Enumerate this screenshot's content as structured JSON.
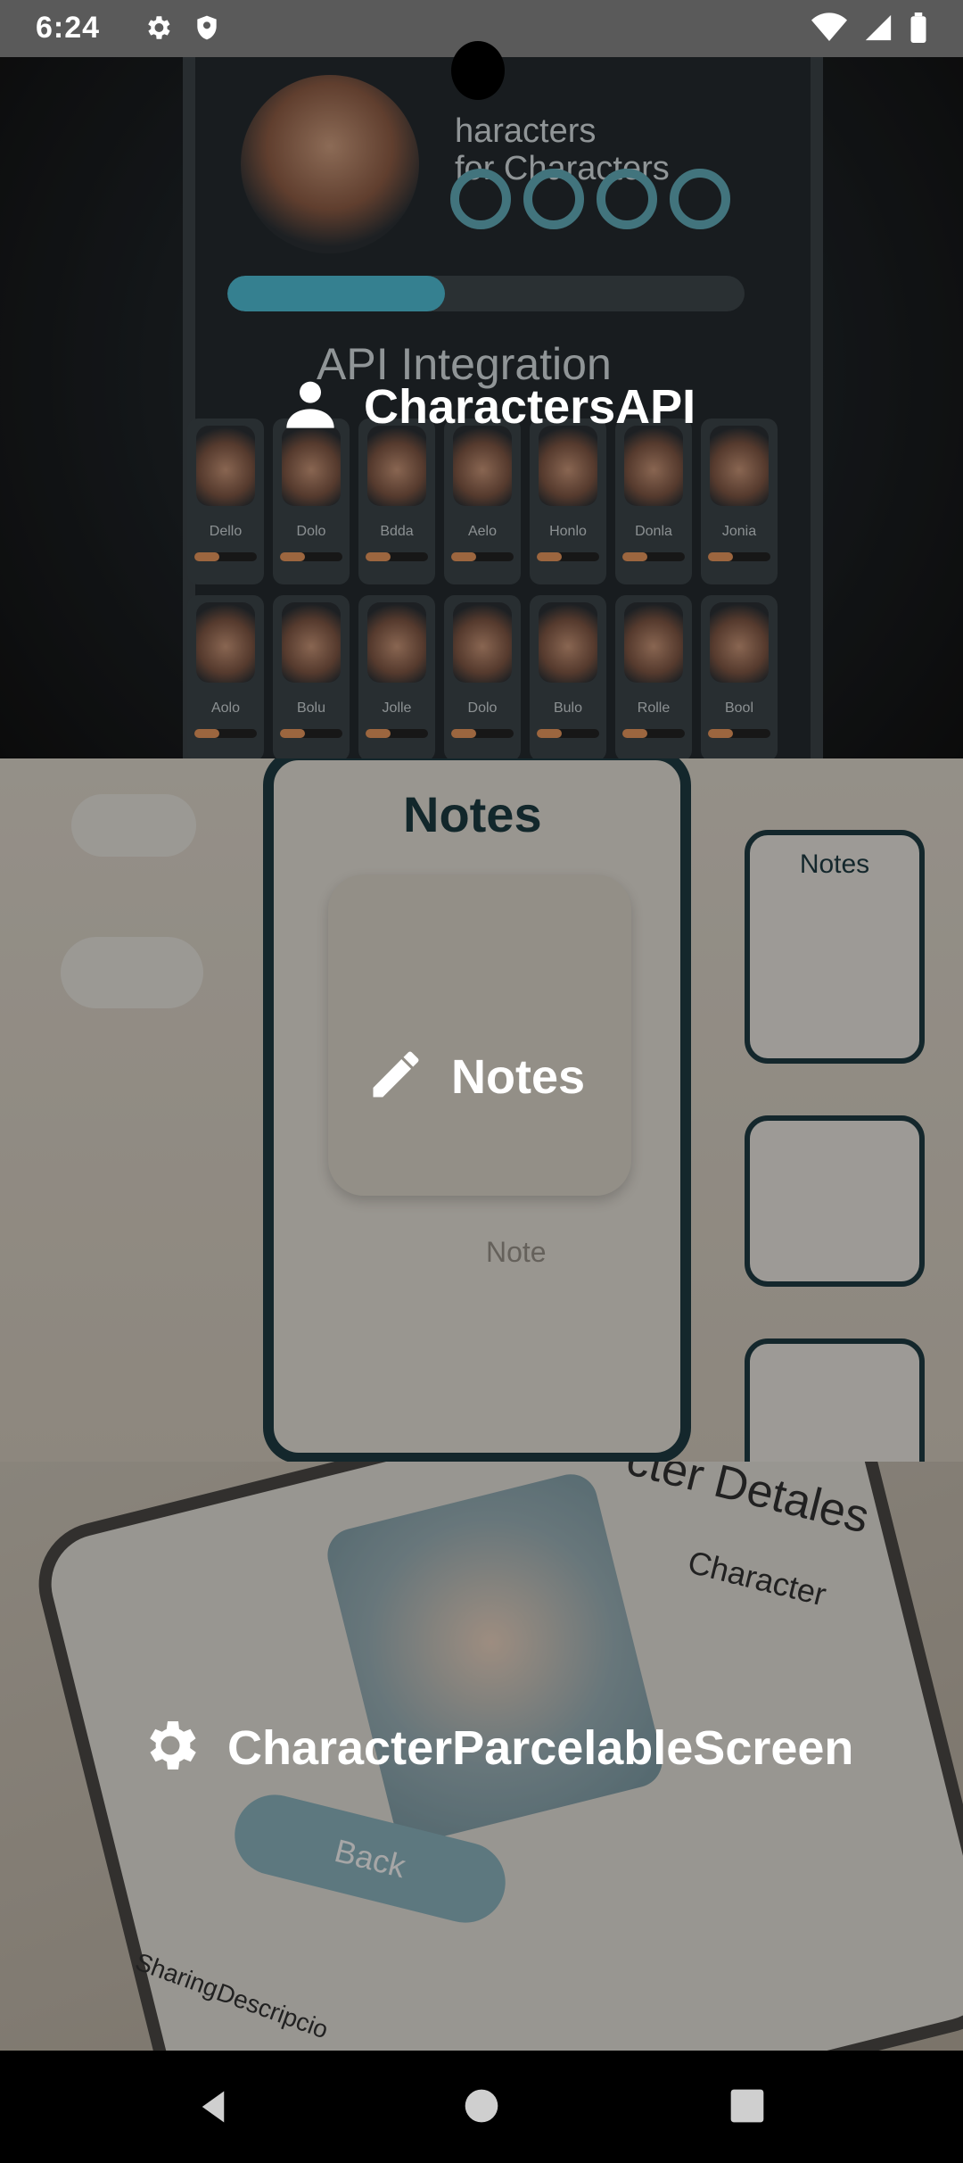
{
  "status_bar": {
    "time": "6:24",
    "icons": [
      "settings-icon",
      "shield-icon",
      "wifi-icon",
      "signal-icon",
      "battery-icon"
    ]
  },
  "menu": {
    "items": [
      {
        "label": "CharactersAPI",
        "icon": "person-icon"
      },
      {
        "label": "Notes",
        "icon": "pencil-icon"
      },
      {
        "label": "CharacterParcelableScreen",
        "icon": "gear-icon"
      }
    ]
  },
  "art": {
    "characters": {
      "title": "API Integration",
      "subtitle_line1": "haracters",
      "subtitle_line2": "for Characters",
      "progress": 0.42,
      "card_names": [
        "Dello",
        "Dolo",
        "Bdda",
        "Aelo",
        "Honlo",
        "Donla",
        "Jonia",
        "Aolo",
        "Bolu",
        "Jolle",
        "Dolo",
        "Bulo",
        "Rolle",
        "Bool"
      ]
    },
    "notes": {
      "title": "Notes",
      "side_title": "Notes",
      "sub_label": "Note"
    },
    "details": {
      "title": "cter Detales",
      "subtitle": "Character",
      "back_label": "Back",
      "footer_left": "Sharing",
      "footer_right": "Descripcio"
    }
  },
  "nav_bar": {
    "buttons": [
      "back-icon",
      "home-icon",
      "recents-icon"
    ]
  },
  "colors": {
    "accent": "#4cb8cf",
    "notes_dark": "#1f3d44",
    "status_bar": "#5a5a5a"
  }
}
